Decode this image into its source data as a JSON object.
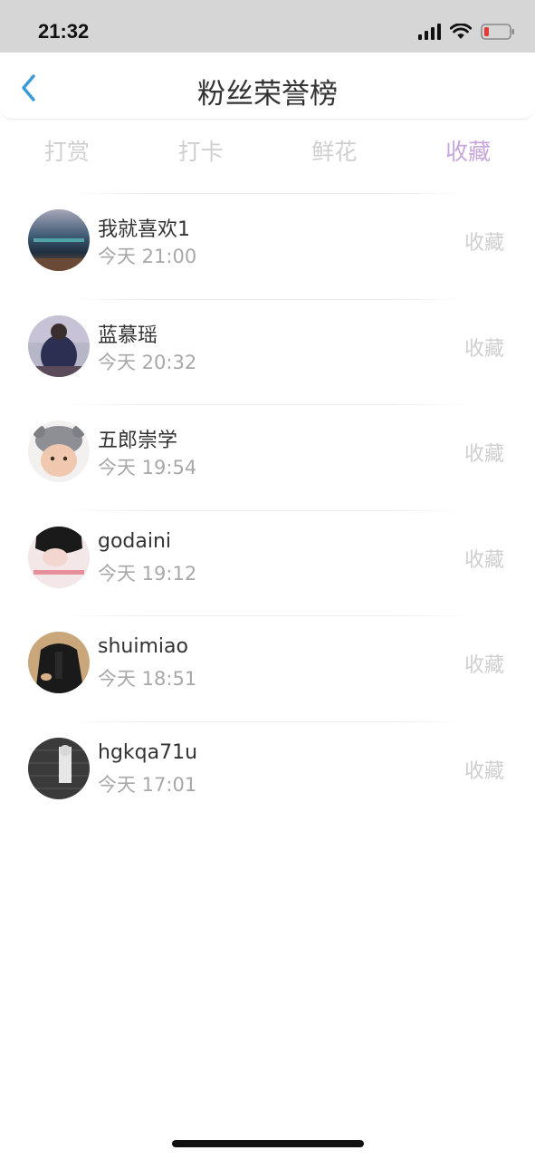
{
  "status_bar": {
    "time": "21:32"
  },
  "header": {
    "title": "粉丝荣誉榜"
  },
  "tabs": [
    {
      "label": "打赏",
      "active": false
    },
    {
      "label": "打卡",
      "active": false
    },
    {
      "label": "鲜花",
      "active": false
    },
    {
      "label": "收藏",
      "active": true
    }
  ],
  "list": {
    "items": [
      {
        "name": "我就喜欢1",
        "time": "今天 21:00",
        "tag": "收藏"
      },
      {
        "name": "蓝慕瑶",
        "time": "今天 20:32",
        "tag": "收藏"
      },
      {
        "name": "五郎崇学",
        "time": "今天 19:54",
        "tag": "收藏"
      },
      {
        "name": "godaini",
        "time": "今天 19:12",
        "tag": "收藏"
      },
      {
        "name": "shuimiao",
        "time": "今天 18:51",
        "tag": "收藏"
      },
      {
        "name": "hgkqa71u",
        "time": "今天 17:01",
        "tag": "收藏"
      }
    ]
  },
  "colors": {
    "accent_tab": "#c7a6dc",
    "back_arrow": "#3a9ad9",
    "inactive": "#cfcfcf",
    "status_bar_bg": "#d6d6d6"
  }
}
